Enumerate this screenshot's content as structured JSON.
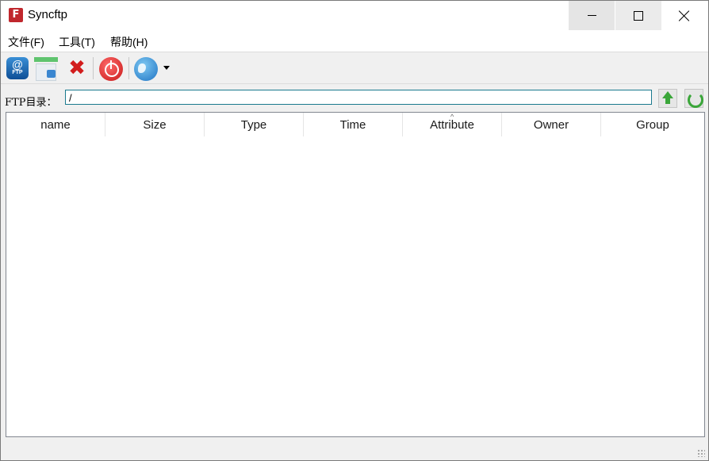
{
  "window": {
    "title": "Syncftp",
    "app_icon_glyph": "F"
  },
  "menu": {
    "items": [
      "文件(F)",
      "工具(T)",
      "帮助(H)"
    ]
  },
  "toolbar": {
    "ftp_icon_symbol": "@",
    "ftp_icon_label": "FTP",
    "delete_symbol": "✖",
    "buttons": [
      "ftp-connect-icon",
      "connection-manager-icon",
      "delete-icon",
      "power-icon",
      "globe-icon"
    ]
  },
  "path": {
    "label": "FTP目录：",
    "value": "/"
  },
  "list": {
    "columns": [
      "name",
      "Size",
      "Type",
      "Time",
      "Attribute",
      "Owner",
      "Group"
    ],
    "rows": []
  },
  "colors": {
    "accent": "#1a7a8e",
    "ok_green": "#3aa639",
    "delete_red": "#d21c1c"
  }
}
